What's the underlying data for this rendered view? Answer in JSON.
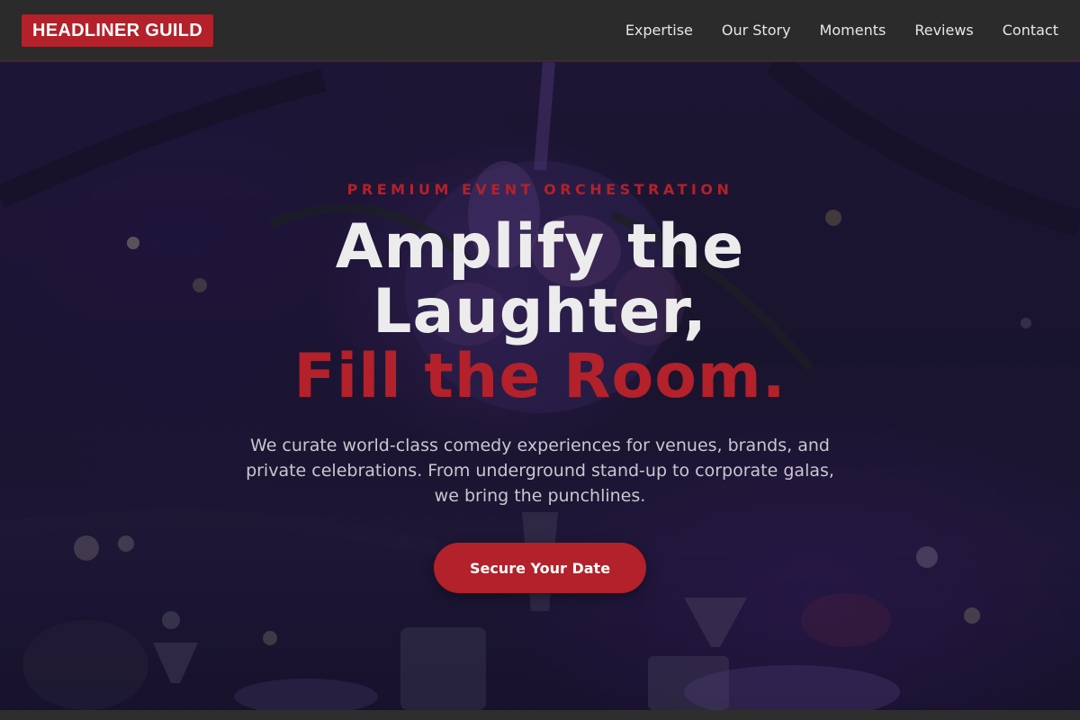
{
  "nav": {
    "brand": "HEADLINER GUILD",
    "links": [
      "Expertise",
      "Our Story",
      "Moments",
      "Reviews",
      "Contact"
    ]
  },
  "hero": {
    "eyebrow": "PREMIUM EVENT ORCHESTRATION",
    "headline_line1": "Amplify the",
    "headline_line2": "Laughter,",
    "headline_line3": "Fill the Room.",
    "subtitle": "We curate world-class comedy experiences for venues, brands, and private celebrations. From underground stand-up to corporate galas, we bring the punchlines.",
    "cta_label": "Secure Your Date"
  },
  "colors": {
    "accent": "#b3212a",
    "nav_background": "#2b2b2b",
    "hero_background": "#1f1836",
    "text_light": "#ececec"
  }
}
